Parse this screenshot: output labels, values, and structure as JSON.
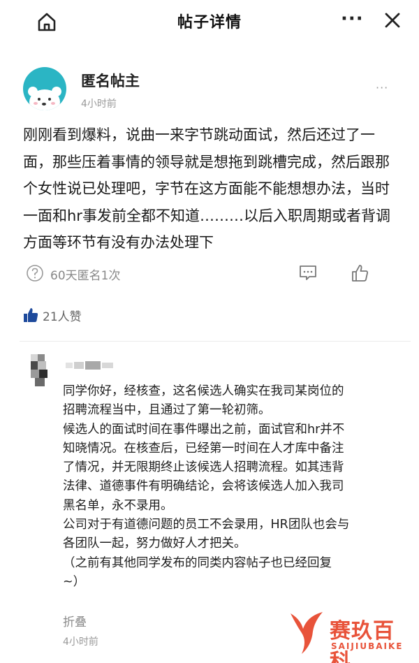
{
  "header": {
    "title": "帖子详情",
    "more": "···",
    "home_icon": "home-icon",
    "close_icon": "close-icon"
  },
  "post": {
    "author": "匿名帖主",
    "time": "4小时前",
    "more": "···",
    "body": "刚刚看到爆料，说曲一来字节跳动面试，然后还过了一面，那些压着事情的领导就是想拖到跳槽完成，然后跟那个女性说已处理吧，字节在这方面能不能想想办法，当时一面和hr事发前全都不知道………以后入职周期或者背调方面等环节有没有办法处理下",
    "anon_note": "60天匿名1次",
    "likes": "21人赞"
  },
  "reply": {
    "lines": [
      "同学你好，经核查，这名候选人确实在我司某岗位的",
      "招聘流程当中，且通过了第一轮初筛。",
      "候选人的面试时间在事件曝出之前，面试官和hr并不",
      "知晓情况。在核查后，已经第一时间在人才库中备注",
      "了情况，并无限期终止该候选人招聘流程。如其违背",
      "法律、道德事件有明确结论，会将该候选人加入我司",
      "黑名单，永不录用。",
      "公司对于有道德问题的员工不会录用，HR团队也会与",
      "各团队一起，努力做好人才把关。",
      "（之前有其他同学发布的同类内容帖子也已经回复",
      "~）"
    ],
    "fold": "折叠",
    "time": "4小时前"
  },
  "watermark": {
    "name": "赛玖百科",
    "pinyin": "SAIJIUBAIKE"
  }
}
